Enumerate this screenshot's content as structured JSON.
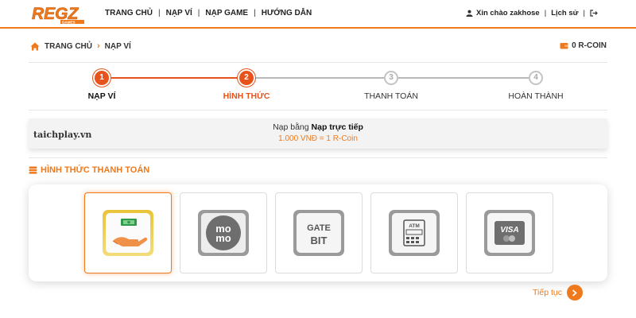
{
  "brand": {
    "logo_text": "REGZ",
    "logo_subtext": "GAMES"
  },
  "nav": {
    "items": [
      "TRANG CHỦ",
      "NẠP VÍ",
      "NẠP GAME",
      "HƯỚNG DẪN"
    ]
  },
  "user": {
    "greeting": "Xin chào zakhose",
    "history": "Lịch sử",
    "logout_icon": "logout-icon"
  },
  "breadcrumb": {
    "home": "TRANG CHỦ",
    "current": "NẠP VÍ"
  },
  "wallet": {
    "balance": "0 R-COIN"
  },
  "steps": [
    {
      "number": "1",
      "label": "NẠP VÍ",
      "state": "done"
    },
    {
      "number": "2",
      "label": "HÌNH THỨC",
      "state": "current"
    },
    {
      "number": "3",
      "label": "THANH TOÁN",
      "state": "pending"
    },
    {
      "number": "4",
      "label": "HOÀN THÀNH",
      "state": "pending"
    }
  ],
  "info": {
    "prefix": "Nạp bằng ",
    "method": "Nạp trực tiếp",
    "rate": "1.000 VNĐ = 1 R-Coin",
    "watermark": "taichplay.vn"
  },
  "section": {
    "title": "HÌNH THỨC THANH TOÁN"
  },
  "payment_methods": [
    {
      "name": "cash-payment",
      "text": "",
      "selected": true
    },
    {
      "name": "momo-payment",
      "text": "mo mo",
      "selected": false
    },
    {
      "name": "gate-payment",
      "text": "GATE BIT",
      "selected": false
    },
    {
      "name": "atm-payment",
      "text": "ATM",
      "selected": false
    },
    {
      "name": "visa-payment",
      "text": "VISA",
      "selected": false
    }
  ],
  "actions": {
    "continue_label": "Tiếp tục"
  },
  "colors": {
    "accent": "#ee7a1d",
    "step_active": "#e8531b",
    "pending": "#c4c4c4"
  }
}
